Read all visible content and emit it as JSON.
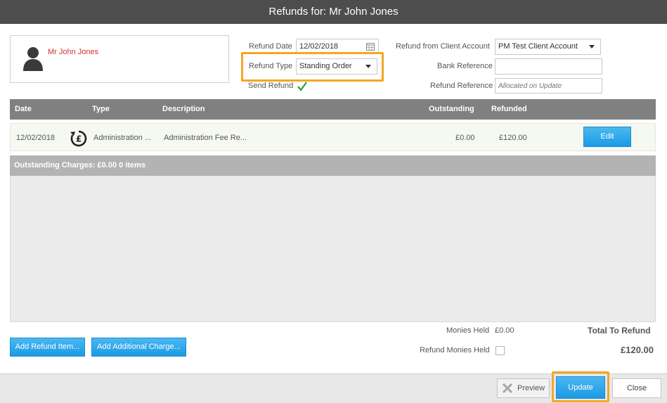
{
  "window": {
    "title": "Refunds for: Mr John Jones"
  },
  "client": {
    "name": "Mr John Jones"
  },
  "form": {
    "refund_date_label": "Refund Date",
    "refund_date_value": "12/02/2018",
    "refund_type_label": "Refund Type",
    "refund_type_value": "Standing Order",
    "send_refund_label": "Send Refund",
    "refund_from_label": "Refund from Client Account",
    "refund_from_value": "PM Test Client Account",
    "bank_ref_label": "Bank Reference",
    "bank_ref_value": "",
    "refund_ref_label": "Refund Reference",
    "refund_ref_placeholder": "Allocated on Update"
  },
  "table": {
    "headers": {
      "date": "Date",
      "type": "Type",
      "description": "Description",
      "outstanding": "Outstanding",
      "refunded": "Refunded"
    },
    "rows": [
      {
        "date": "12/02/2018",
        "type": "Administration ...",
        "description": "Administration Fee Re...",
        "outstanding": "£0.00",
        "refunded": "£120.00",
        "edit_label": "Edit"
      }
    ],
    "summary": "Outstanding Charges: £0.00 0 items"
  },
  "totals": {
    "monies_held_label": "Monies Held",
    "monies_held_value": "£0.00",
    "refund_monies_held_label": "Refund Monies Held",
    "total_label": "Total To Refund",
    "total_value": "£120.00"
  },
  "actions": {
    "add_refund_item": "Add Refund Item...",
    "add_additional_charge": "Add Additional Charge...",
    "preview": "Preview",
    "update": "Update",
    "close": "Close"
  },
  "colors": {
    "accent": "#1b9ae4",
    "highlight": "#f5a623",
    "client_name": "#d0312d",
    "check": "#2e9e2e"
  }
}
